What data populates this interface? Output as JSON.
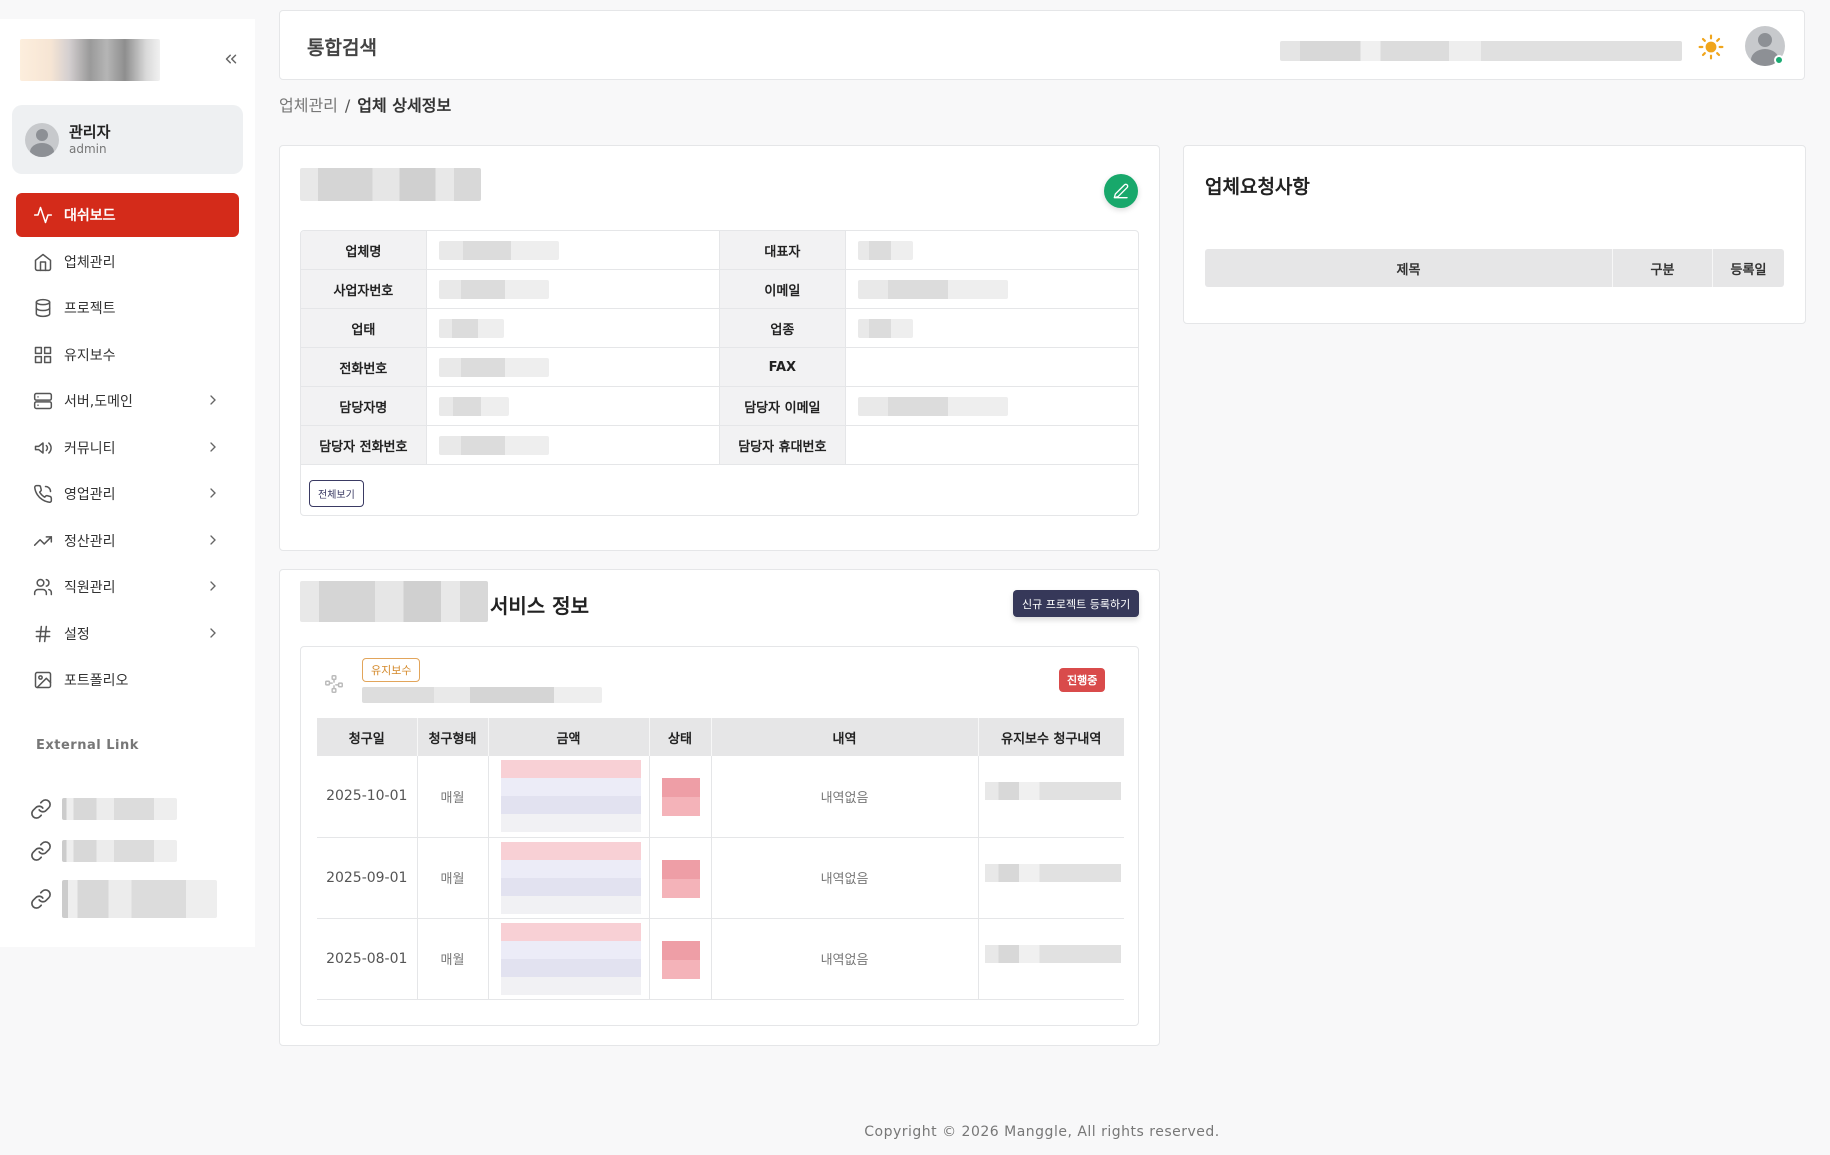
{
  "header": {
    "title": "통합검색"
  },
  "sidebar": {
    "user": {
      "name": "관리자",
      "role": "admin"
    },
    "items": [
      {
        "label": "대쉬보드",
        "icon": "activity-icon",
        "active": true,
        "expandable": false
      },
      {
        "label": "업체관리",
        "icon": "home-icon",
        "active": false,
        "expandable": false
      },
      {
        "label": "프로젝트",
        "icon": "database-icon",
        "active": false,
        "expandable": false
      },
      {
        "label": "유지보수",
        "icon": "grid-icon",
        "active": false,
        "expandable": false
      },
      {
        "label": "서버,도메인",
        "icon": "server-icon",
        "active": false,
        "expandable": true
      },
      {
        "label": "커뮤니티",
        "icon": "megaphone-icon",
        "active": false,
        "expandable": true
      },
      {
        "label": "영업관리",
        "icon": "phone-icon",
        "active": false,
        "expandable": true
      },
      {
        "label": "정산관리",
        "icon": "trending-up-icon",
        "active": false,
        "expandable": true
      },
      {
        "label": "직원관리",
        "icon": "users-icon",
        "active": false,
        "expandable": true
      },
      {
        "label": "설정",
        "icon": "hash-icon",
        "active": false,
        "expandable": true
      },
      {
        "label": "포트폴리오",
        "icon": "image-icon",
        "active": false,
        "expandable": false
      }
    ],
    "external_title": "External Link"
  },
  "breadcrumb": {
    "parent": "업체관리",
    "separator": "/",
    "current": "업체 상세정보"
  },
  "company_info": {
    "labels": {
      "company_name": "업체명",
      "ceo": "대표자",
      "biz_no": "사업자번호",
      "email": "이메일",
      "biz_type": "업태",
      "biz_item": "업종",
      "phone": "전화번호",
      "fax": "FAX",
      "manager": "담당자명",
      "manager_email": "담당자 이메일",
      "manager_phone": "담당자 전화번호",
      "manager_mobile": "담당자 휴대번호"
    },
    "view_all_label": "전체보기"
  },
  "requests": {
    "title": "업체요청사항",
    "columns": [
      "제목",
      "구분",
      "등록일"
    ]
  },
  "service": {
    "title_suffix": "서비스 정보",
    "new_project_label": "신규 프로젝트 등록하기",
    "type_badge": "유지보수",
    "status_badge": "진행중",
    "columns": [
      "청구일",
      "청구형태",
      "금액",
      "상태",
      "내역",
      "유지보수 청구내역"
    ],
    "rows": [
      {
        "date": "2025-10-01",
        "type": "매월",
        "history": "내역없음"
      },
      {
        "date": "2025-09-01",
        "type": "매월",
        "history": "내역없음"
      },
      {
        "date": "2025-08-01",
        "type": "매월",
        "history": "내역없음"
      }
    ]
  },
  "footer": {
    "copyright": "Copyright © 2026 Manggle, All rights reserved."
  },
  "colors": {
    "accent": "#d42b1a",
    "edit": "#18a86b",
    "status_red": "#d94b4b",
    "maint_orange": "#d4892a",
    "dark_button": "#363859"
  }
}
